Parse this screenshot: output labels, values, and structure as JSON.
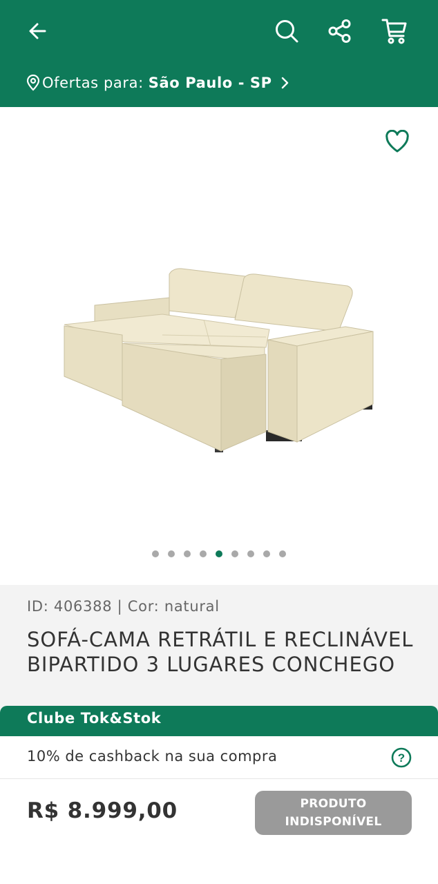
{
  "header": {
    "icons": {
      "back": "arrow-left-icon",
      "search": "search-icon",
      "share": "share-icon",
      "cart": "cart-icon"
    },
    "location": {
      "prefix": "Ofertas para:",
      "city": "São Paulo - SP"
    }
  },
  "gallery": {
    "image_description_icon": "sofa-image",
    "dots_total": 9,
    "active_dot": 5
  },
  "product": {
    "meta": "ID: 406388 | Cor: natural",
    "title": "SOFÁ-CAMA RETRÁTIL E RECLINÁVEL BIPARTIDO 3 LUGARES CONCHEGO"
  },
  "club": {
    "label": "Clube Tok&Stok",
    "cashback": "10% de cashback na sua compra"
  },
  "purchase": {
    "price": "R$ 8.999,00",
    "button_label": "PRODUTO\nINDISPONÍVEL"
  },
  "colors": {
    "brand_green": "#0e7a59",
    "disabled_gray": "#9a9a9a"
  }
}
